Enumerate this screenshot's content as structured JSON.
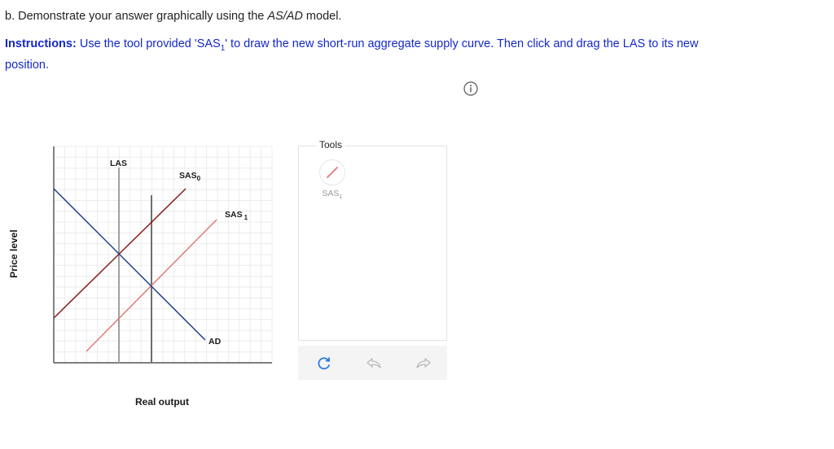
{
  "question": {
    "prefix": "b. Demonstrate your answer graphically using the ",
    "model": "AS/AD",
    "suffix": " model."
  },
  "instructions": {
    "label": "Instructions:",
    "text_before": " Use the tool provided 'SAS",
    "text_sub": "1",
    "text_after": "' to draw the new short-run aggregate supply curve. Then click and drag the LAS to its new position."
  },
  "info_icon": "info-circle-icon",
  "graph": {
    "ylabel": "Price level",
    "xlabel": "Real output",
    "curves": {
      "las": {
        "label": "LAS",
        "color": "#9a9a9a"
      },
      "sas0": {
        "label": "SAS",
        "sub": "0",
        "color": "#8b1a1a"
      },
      "sas1": {
        "label": "SAS",
        "sub": "1",
        "color": "#e07a7a"
      },
      "ad": {
        "label": "AD",
        "color": "#1f3f8f"
      },
      "las_new": {
        "color": "#666666"
      }
    },
    "grid_color": "#ececec"
  },
  "tools": {
    "title": "Tools",
    "items": [
      {
        "label": "SAS",
        "sub": "1",
        "icon": "line-draw-icon",
        "color": "#e07a7a"
      }
    ]
  },
  "controls": {
    "reset_icon": "reset-icon",
    "undo_icon": "undo-icon",
    "redo_icon": "redo-icon",
    "accent": "#2a7de1"
  }
}
